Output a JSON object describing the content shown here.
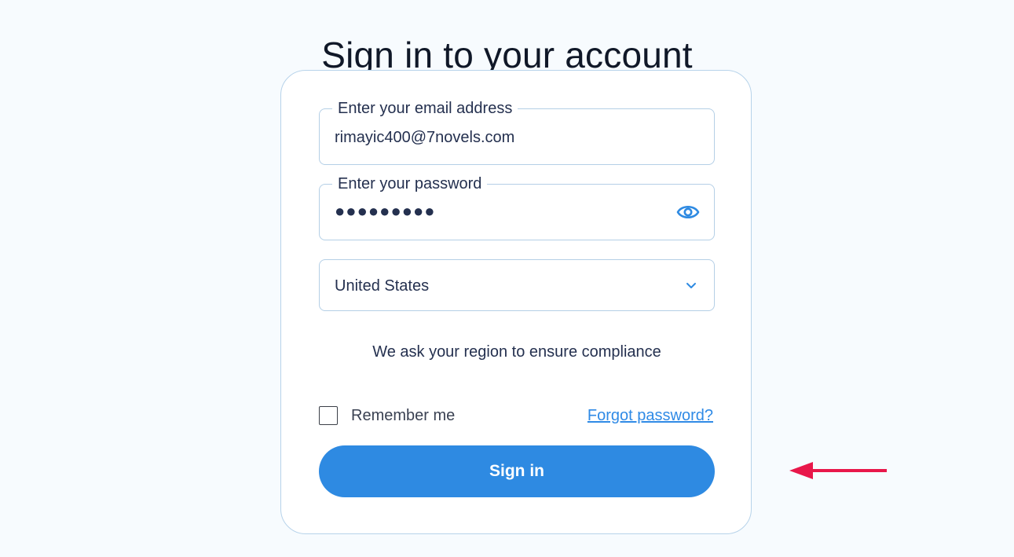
{
  "page": {
    "title": "Sign in to your account"
  },
  "form": {
    "email": {
      "label": "Enter your email address",
      "value": "rimayic400@7novels.com"
    },
    "password": {
      "label": "Enter your password",
      "masked_value": "●●●●●●●●●",
      "toggle_icon": "eye-icon"
    },
    "region": {
      "selected": "United States",
      "dropdown_icon": "chevron-down-icon"
    },
    "region_note": "We ask your region to ensure compliance",
    "remember_me": {
      "label": "Remember me",
      "checked": false
    },
    "forgot_password": "Forgot password?",
    "submit_label": "Sign in"
  },
  "annotation": {
    "arrow_color": "#e8174a",
    "arrow_icon": "left-arrow-icon"
  },
  "colors": {
    "accent": "#2e8ae2",
    "link": "#2f8ae6",
    "border": "#b4cfe6",
    "page_background": "#f7fbfe"
  }
}
